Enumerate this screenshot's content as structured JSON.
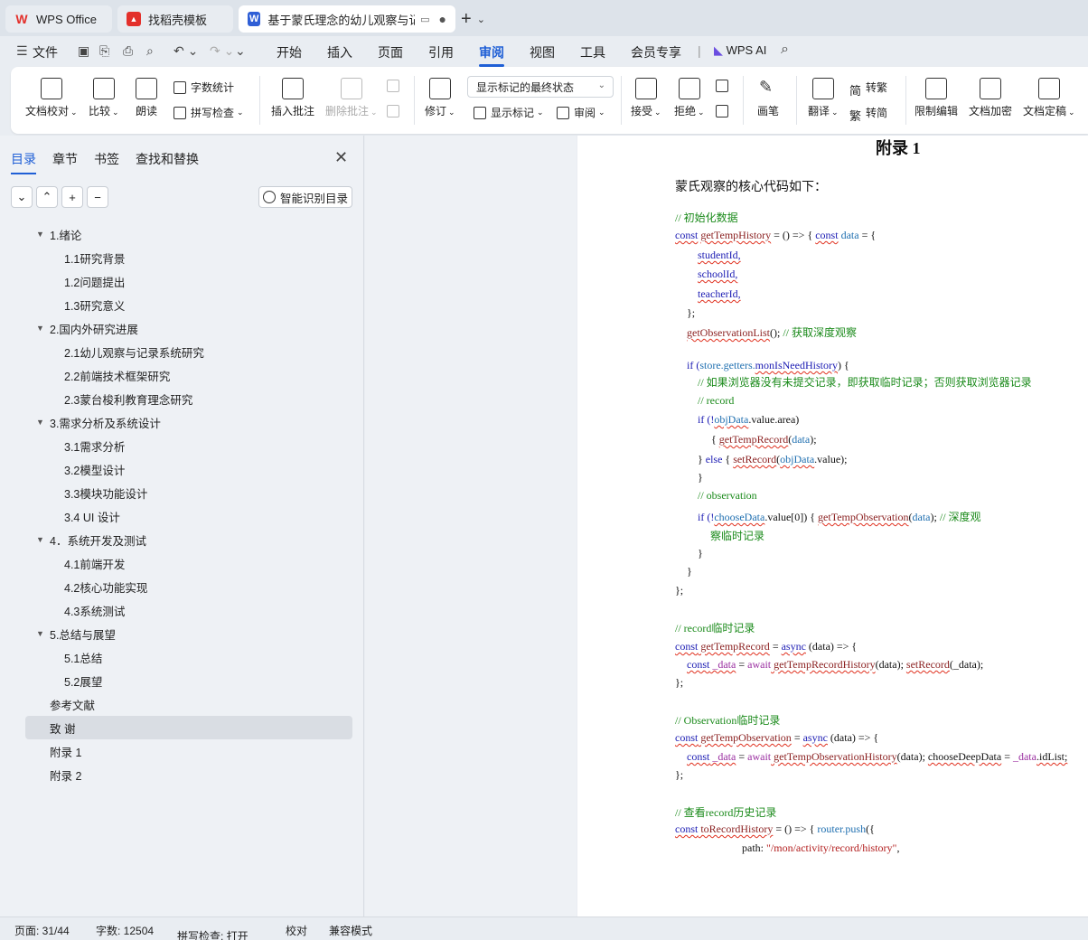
{
  "tabs": [
    {
      "label": "WPS Office",
      "logo": "W",
      "logo_color": "#e3302b"
    },
    {
      "label": "找稻壳模板",
      "logo": "▲",
      "logo_color": "#e3302b"
    },
    {
      "label": "基于蒙氏理念的幼儿观察与记录",
      "logo": "W",
      "logo_color": "#2f5fd6"
    }
  ],
  "menu": {
    "file": "文件",
    "items": [
      "开始",
      "插入",
      "页面",
      "引用",
      "审阅",
      "视图",
      "工具",
      "会员专享"
    ],
    "active": "审阅",
    "wps_ai": "WPS AI"
  },
  "ribbon": {
    "doc_check": "文档校对",
    "compare": "比较",
    "read": "朗读",
    "word_count": "字数统计",
    "spell_check": "拼写检查",
    "insert_comment": "插入批注",
    "delete_comment": "删除批注",
    "track_changes": "修订",
    "display_select": "显示标记的最终状态",
    "show_markup": "显示标记",
    "review": "审阅",
    "accept": "接受",
    "reject": "拒绝",
    "ink": "画笔",
    "translate": "翻译",
    "trad": "转繁",
    "simp": "转简",
    "restrict": "限制编辑",
    "encrypt": "文档加密",
    "finalize": "文档定稿"
  },
  "nav": {
    "tabs": [
      "目录",
      "章节",
      "书签",
      "查找和替换"
    ],
    "active_tab": "目录",
    "smart_btn": "智能识别目录",
    "toc": [
      {
        "label": "1.绪论",
        "level": 1
      },
      {
        "label": "1.1研究背景",
        "level": 2
      },
      {
        "label": "1.2问题提出",
        "level": 2
      },
      {
        "label": "1.3研究意义",
        "level": 2
      },
      {
        "label": "2.国内外研究进展",
        "level": 1
      },
      {
        "label": "2.1幼儿观察与记录系统研究",
        "level": 2
      },
      {
        "label": "2.2前端技术框架研究",
        "level": 2
      },
      {
        "label": "2.3蒙台梭利教育理念研究",
        "level": 2
      },
      {
        "label": "3.需求分析及系统设计",
        "level": 1
      },
      {
        "label": "3.1需求分析",
        "level": 2
      },
      {
        "label": "3.2模型设计",
        "level": 2
      },
      {
        "label": "3.3模块功能设计",
        "level": 2
      },
      {
        "label": "3.4 UI 设计",
        "level": 2
      },
      {
        "label": "4．系统开发及测试",
        "level": 1
      },
      {
        "label": "4.1前端开发",
        "level": 2
      },
      {
        "label": "4.2核心功能实现",
        "level": 2
      },
      {
        "label": "4.3系统测试",
        "level": 2
      },
      {
        "label": "5.总结与展望",
        "level": 1
      },
      {
        "label": "5.1总结",
        "level": 2
      },
      {
        "label": "5.2展望",
        "level": 2
      },
      {
        "label": "参考文献",
        "level": 0
      },
      {
        "label": "致 谢",
        "level": 0,
        "selected": true
      },
      {
        "label": "附录 1",
        "level": 0
      },
      {
        "label": "附录 2",
        "level": 0
      }
    ]
  },
  "document": {
    "title": "附录 1",
    "intro": "蒙氏观察的核心代码如下：",
    "code": {
      "c1": "// 初始化数据",
      "l2a": "const",
      "l2b": "getTempHistory",
      "l2c": " = () => { ",
      "l2d": "const",
      "l2e": " data",
      "l2f": " = {",
      "l3": "studentId,",
      "l4": "schoolId,",
      "l5": "teacherId,",
      "l6": "};",
      "l7a": "getObservationList",
      "l7b": "(); ",
      "l7c": "// 获取深度观察",
      "l8a": "if (",
      "l8b": "store.getters.",
      "l8c": "monIsNeedHistory",
      "l8d": ") {",
      "c9": "// 如果浏览器没有未提交记录，即获取临时记录；否则获取浏览器记录",
      "c10": "// record",
      "l11a": "if (!",
      "l11b": "objData",
      "l11c": ".value.area)",
      "l12a": "{ ",
      "l12b": "getTempRecord",
      "l12c": "(",
      "l12d": "data",
      "l12e": ");",
      "l13a": "} ",
      "l13b": "else",
      "l13c": " { ",
      "l13d": "setRecord",
      "l13e": "(",
      "l13f": "objData",
      "l13g": ".value);",
      "l14": "}",
      "c15": "// observation",
      "l16a": "if (!",
      "l16b": "chooseData",
      "l16c": ".value[0]) { ",
      "l16d": "getTempObservation",
      "l16e": "(",
      "l16f": "data",
      "l16g": "); ",
      "l16h": "// 深度观",
      "l17": "察临时记录",
      "l18": "}",
      "l19": "}",
      "l20": "};",
      "c21": "// record临时记录",
      "l22a": "const",
      "l22b": " getTempRecord",
      "l22c": " = ",
      "l22d": "async",
      "l22e": " (data) => {",
      "l23a": "const",
      "l23b": " _data",
      "l23c": " = ",
      "l23d": "await",
      "l23e": " getTempRecordHistory",
      "l23f": "(data); ",
      "l23g": "setRecord",
      "l23h": "(_data);",
      "l24": "};",
      "c25": "// Observation临时记录",
      "l26a": "const",
      "l26b": " getTempObservation",
      "l26c": " = ",
      "l26d": "async",
      "l26e": " (data) => {",
      "l27a": "const",
      "l27b": " _data",
      "l27c": " = ",
      "l27d": "await",
      "l27e": " getTempObservationHistory",
      "l27f": "(data); ",
      "l27g": "chooseDeepData",
      "l27h": " = ",
      "l27i": "_data",
      "l27j": ".idList;",
      "l28": "};",
      "c29": "// 查看record历史记录",
      "l30a": "const",
      "l30b": " toRecordHistory",
      "l30c": " = () => { ",
      "l30d": "router.push",
      "l30e": "({",
      "l31a": "path: ",
      "l31b": "\"/mon/activity/record/history\"",
      "l31c": ","
    }
  },
  "status": {
    "page": "页面: 31/44",
    "words": "字数: 12504",
    "spell": "拼写检查: 打开",
    "proof": "校对",
    "compat": "兼容模式"
  }
}
